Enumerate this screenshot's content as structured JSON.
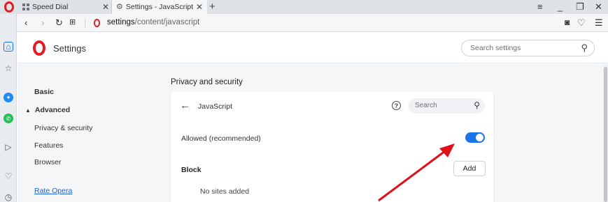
{
  "tabs": [
    {
      "title": "Speed Dial",
      "icon": "speed-dial-icon",
      "active": false
    },
    {
      "title": "Settings - JavaScript",
      "icon": "gear-icon",
      "active": true
    }
  ],
  "address": {
    "host": "settings",
    "path": "/content/javascript"
  },
  "settings": {
    "title": "Settings",
    "search_placeholder": "Search settings"
  },
  "nav": {
    "basic": "Basic",
    "advanced": "Advanced",
    "privacy": "Privacy & security",
    "features": "Features",
    "browser": "Browser",
    "rate": "Rate Opera"
  },
  "main": {
    "section_title": "Privacy and security",
    "card_title": "JavaScript",
    "search_placeholder": "Search",
    "allowed_label": "Allowed (recommended)",
    "allowed_enabled": true,
    "block_label": "Block",
    "add_label": "Add",
    "no_sites": "No sites added"
  },
  "colors": {
    "accent": "#1a73e8",
    "brand": "#e21b25",
    "annotation": "#e0101a"
  }
}
